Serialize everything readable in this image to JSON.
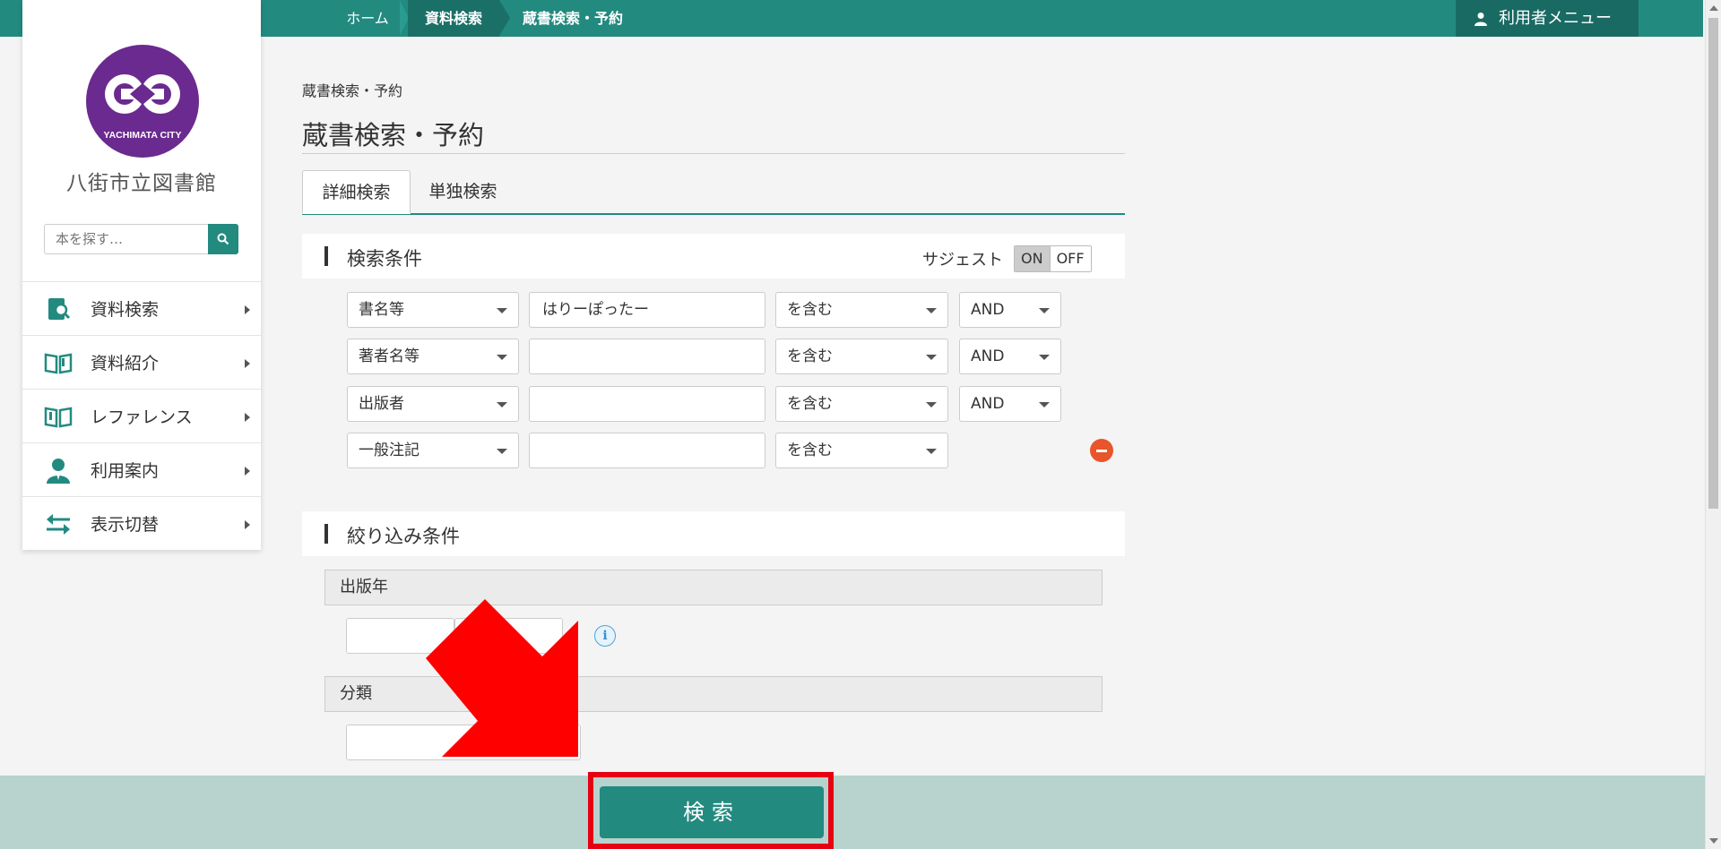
{
  "topbar": {
    "breadcrumb": [
      "ホーム",
      "資料検索",
      "蔵書検索・予約"
    ],
    "user_menu_label": "利用者メニュー"
  },
  "sidebar": {
    "logo_text": "YACHIMATA CITY",
    "library_name": "八街市立図書館",
    "search_placeholder": "本を探す…",
    "items": [
      {
        "label": "資料検索",
        "icon": "book-search-icon"
      },
      {
        "label": "資料紹介",
        "icon": "open-book-icon"
      },
      {
        "label": "レファレンス",
        "icon": "open-book-icon"
      },
      {
        "label": "利用案内",
        "icon": "person-icon"
      },
      {
        "label": "表示切替",
        "icon": "switch-arrows-icon"
      }
    ]
  },
  "main": {
    "small_breadcrumb": "蔵書検索・予約",
    "title": "蔵書検索・予約",
    "tabs": [
      "詳細検索",
      "単独検索"
    ],
    "search_conditions": {
      "heading": "検索条件",
      "suggest_label": "サジェスト",
      "toggle_on": "ON",
      "toggle_off": "OFF",
      "rows": [
        {
          "field": "書名等",
          "value": "はりーぽったー",
          "match": "を含む",
          "op": "AND"
        },
        {
          "field": "著者名等",
          "value": "",
          "match": "を含む",
          "op": "AND"
        },
        {
          "field": "出版者",
          "value": "",
          "match": "を含む",
          "op": "AND"
        },
        {
          "field": "一般注記",
          "value": "",
          "match": "を含む",
          "op": ""
        }
      ]
    },
    "filter_conditions": {
      "heading": "絞り込み条件",
      "publication_year_label": "出版年",
      "classification_label": "分類"
    }
  },
  "footer": {
    "search_button_label": "検索"
  },
  "colors": {
    "accent": "#238a80",
    "bottom_bar": "#b8d2cd",
    "highlight": "#e60012",
    "minus": "#e8552a"
  }
}
